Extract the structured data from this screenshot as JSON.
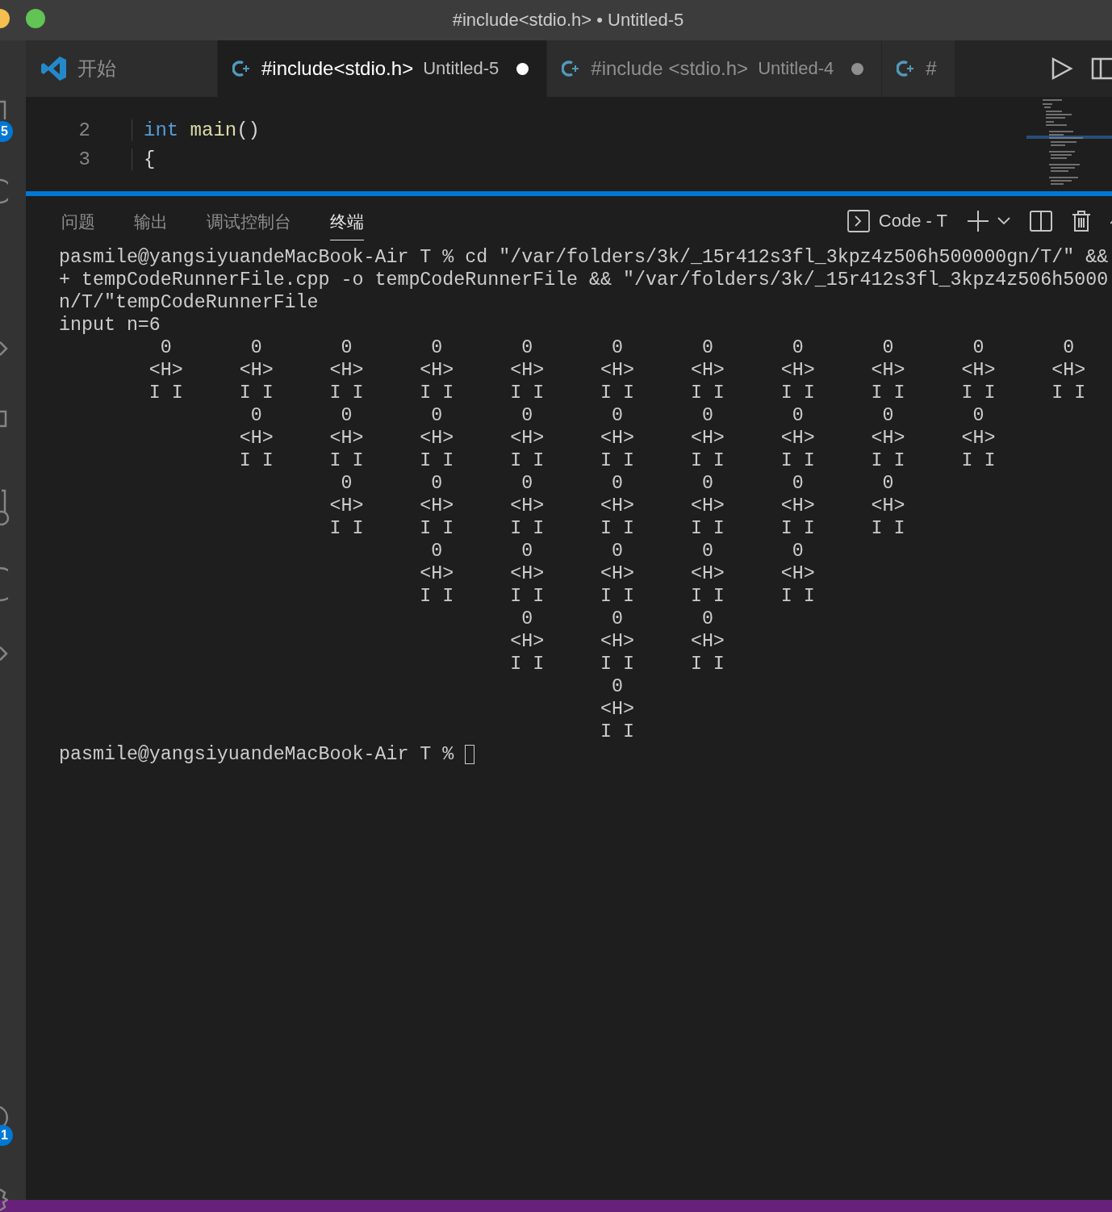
{
  "window": {
    "title": "#include<stdio.h> • Untitled-5"
  },
  "activity_bar": {
    "badges": [
      "5",
      "1"
    ]
  },
  "tabs": [
    {
      "kind": "welcome",
      "label": "开始",
      "selected": false
    },
    {
      "kind": "cpp",
      "label": "#include<stdio.h>",
      "description": "Untitled-5",
      "dirty": true,
      "selected": true
    },
    {
      "kind": "cpp",
      "label": "#include <stdio.h>",
      "description": "Untitled-4",
      "dirty": true,
      "selected": false
    },
    {
      "kind": "cpp",
      "label": "#",
      "selected": false
    }
  ],
  "editor": {
    "lines": [
      {
        "number": "2",
        "tokens": [
          {
            "kind": "keyword",
            "text": "int"
          },
          {
            "kind": "function",
            "text": "main"
          },
          {
            "kind": "plain",
            "text": "()"
          }
        ]
      },
      {
        "number": "3",
        "tokens": [
          {
            "kind": "plain",
            "text": "{"
          }
        ]
      }
    ]
  },
  "panel": {
    "tabs": [
      {
        "label": "问题",
        "selected": false
      },
      {
        "label": "输出",
        "selected": false
      },
      {
        "label": "调试控制台",
        "selected": false
      },
      {
        "label": "终端",
        "selected": true
      }
    ],
    "terminal_name": "Code - T",
    "terminal_lines": [
      "pasmile@yangsiyuandeMacBook-Air T % cd \"/var/folders/3k/_15r412s3fl_3kpz4z506h500000gn/T/\" &&",
      "+ tempCodeRunnerFile.cpp -o tempCodeRunnerFile && \"/var/folders/3k/_15r412s3fl_3kpz4z506h5000",
      "n/T/\"tempCodeRunnerFile",
      "input n=6",
      "         0       0       0       0       0       0       0       0       0       0       0",
      "        <H>     <H>     <H>     <H>     <H>     <H>     <H>     <H>     <H>     <H>     <H>",
      "        I I     I I     I I     I I     I I     I I     I I     I I     I I     I I     I I",
      "                 0       0       0       0       0       0       0       0       0",
      "                <H>     <H>     <H>     <H>     <H>     <H>     <H>     <H>     <H>",
      "                I I     I I     I I     I I     I I     I I     I I     I I     I I",
      "                         0       0       0       0       0       0       0",
      "                        <H>     <H>     <H>     <H>     <H>     <H>     <H>",
      "                        I I     I I     I I     I I     I I     I I     I I",
      "                                 0       0       0       0       0",
      "                                <H>     <H>     <H>     <H>     <H>",
      "                                I I     I I     I I     I I     I I",
      "                                         0       0       0",
      "                                        <H>     <H>     <H>",
      "                                        I I     I I     I I",
      "                                                 0",
      "                                                <H>",
      "                                                I I"
    ],
    "prompt": "pasmile@yangsiyuandeMacBook-Air T %"
  }
}
